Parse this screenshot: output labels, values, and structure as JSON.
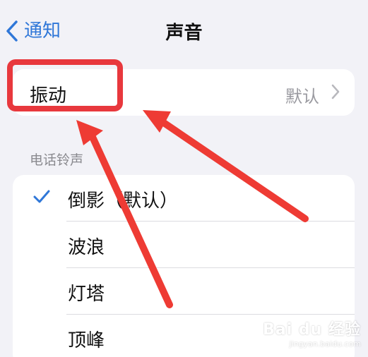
{
  "nav": {
    "back_label": "通知",
    "title": "声音",
    "back_icon": "chevron-left-icon",
    "accent_color": "#2f77d8"
  },
  "vibration": {
    "label": "振动",
    "value": "默认",
    "chevron_icon": "chevron-right-icon"
  },
  "ringtones": {
    "header": "电话铃声",
    "items": [
      {
        "label": "倒影（默认）",
        "selected": true
      },
      {
        "label": "波浪",
        "selected": false
      },
      {
        "label": "灯塔",
        "selected": false
      },
      {
        "label": "顶峰",
        "selected": false
      }
    ],
    "check_icon": "checkmark-icon"
  },
  "annotation": {
    "highlight_color": "#e8383d",
    "arrow_icon": "red-arrow"
  },
  "watermark": {
    "logo": "Bai du 经验",
    "url": "jingyan.baidu.com"
  }
}
